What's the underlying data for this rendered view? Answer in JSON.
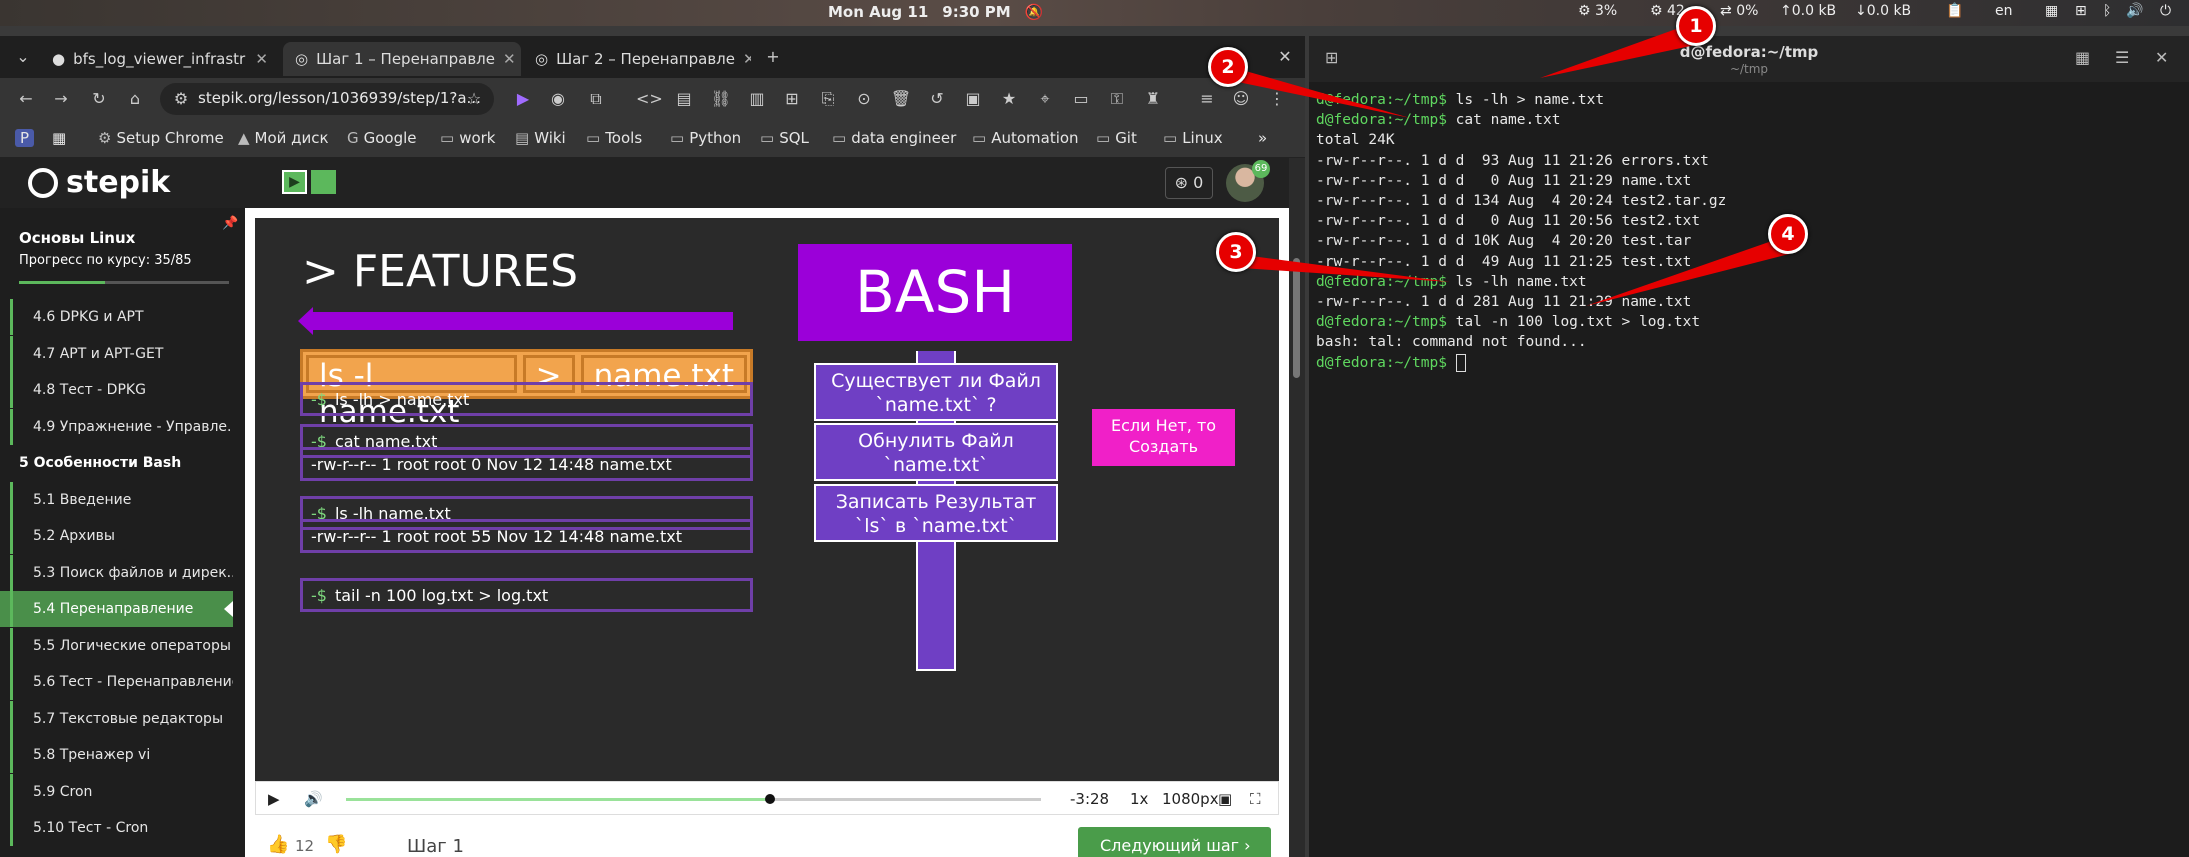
{
  "topbar": {
    "date": "Mon Aug 11",
    "time": "9:30 PM",
    "cpu": "3%",
    "cpu2": "42",
    "net_pct": "0%",
    "up": "↑0.0 kB",
    "down": "↓0.0 kB",
    "lang": "en"
  },
  "browser": {
    "tabs": [
      {
        "label": "bfs_log_viewer_infrastr",
        "icon": "github-icon"
      },
      {
        "label": "Шаг 1 – Перенаправле",
        "icon": "stepik-icon"
      },
      {
        "label": "Шаг 2 – Перенаправле",
        "icon": "stepik-icon"
      }
    ],
    "url": "stepik.org/lesson/1036939/step/1?a...",
    "bookmarks": [
      "Setup Chrome",
      "Мой диск",
      "Google",
      "work",
      "Wiki",
      "Tools",
      "Python",
      "SQL",
      "data engineer",
      "Automation",
      "Git",
      "Linux"
    ]
  },
  "stepik": {
    "logo": "stepik",
    "points": "0",
    "avatar_badge": "69",
    "course_title": "Основы Linux",
    "course_progress": "Прогресс по курсу:  35/85",
    "progress_fraction": 0.41,
    "items": [
      {
        "label": "4.6  DPKG и APT",
        "type": "item"
      },
      {
        "label": "4.7  APT и APT-GET",
        "type": "item"
      },
      {
        "label": "4.8  Тест - DPKG",
        "type": "item"
      },
      {
        "label": "4.9  Упражнение - Управле...",
        "type": "item"
      },
      {
        "label": "5  Особенности Bash",
        "type": "module"
      },
      {
        "label": "5.1  Введение",
        "type": "item"
      },
      {
        "label": "5.2  Архивы",
        "type": "item"
      },
      {
        "label": "5.3  Поиск файлов и дирек...",
        "type": "item"
      },
      {
        "label": "5.4  Перенаправление",
        "type": "active"
      },
      {
        "label": "5.5  Логические операторы",
        "type": "item"
      },
      {
        "label": "5.6  Тест - Перенаправление",
        "type": "item"
      },
      {
        "label": "5.7  Текстовые редакторы",
        "type": "item"
      },
      {
        "label": "5.8  Тренажер vi",
        "type": "item"
      },
      {
        "label": "5.9  Cron",
        "type": "item"
      },
      {
        "label": "5.10  Тест - Cron",
        "type": "item"
      }
    ],
    "slide": {
      "features": "> FEATURES",
      "bash": "BASH",
      "cmd_parts": [
        "ls  -l  name.txt",
        ">",
        "name.txt"
      ],
      "lines": [
        {
          "prompt": "-$",
          "text": "ls  -lh  >  name.txt"
        },
        {
          "prompt": "-$",
          "text": "cat  name.txt"
        },
        {
          "prompt": "",
          "text": "-rw-r--r-- 1 root root 0 Nov 12 14:48 name.txt"
        },
        {
          "prompt": "-$",
          "text": "ls  -lh  name.txt"
        },
        {
          "prompt": "",
          "text": "-rw-r--r-- 1 root root 55 Nov 12 14:48 name.txt"
        },
        {
          "prompt": "-$",
          "text": "tail  -n  100  log.txt  >  log.txt"
        }
      ],
      "flow": [
        "Существует ли Файл `name.txt` ?",
        "Обнулить Файл `name.txt`",
        "Записать Результат `ls` в `name.txt`"
      ],
      "if_not": "Если Нет, то Создать"
    },
    "player": {
      "remaining": "-3:28",
      "speed": "1x",
      "quality": "1080px",
      "progress_fraction": 0.61
    },
    "likes": "12",
    "step_label": "Шаг 1",
    "next_label": "Следующий шаг"
  },
  "terminal": {
    "title": "d@fedora:~/tmp",
    "subtitle": "~/tmp",
    "lines": [
      {
        "prompt": "d@fedora:~/tmp$",
        "text": " ls -lh > name.txt"
      },
      {
        "prompt": "d@fedora:~/tmp$",
        "text": " cat name.txt"
      },
      {
        "prompt": "",
        "text": "total 24K"
      },
      {
        "prompt": "",
        "text": "-rw-r--r--. 1 d d  93 Aug 11 21:26 errors.txt"
      },
      {
        "prompt": "",
        "text": "-rw-r--r--. 1 d d   0 Aug 11 21:29 name.txt"
      },
      {
        "prompt": "",
        "text": "-rw-r--r--. 1 d d 134 Aug  4 20:24 test2.tar.gz"
      },
      {
        "prompt": "",
        "text": "-rw-r--r--. 1 d d   0 Aug 11 20:56 test2.txt"
      },
      {
        "prompt": "",
        "text": "-rw-r--r--. 1 d d 10K Aug  4 20:20 test.tar"
      },
      {
        "prompt": "",
        "text": "-rw-r--r--. 1 d d  49 Aug 11 21:25 test.txt"
      },
      {
        "prompt": "d@fedora:~/tmp$",
        "text": " ls -lh name.txt"
      },
      {
        "prompt": "",
        "text": "-rw-r--r--. 1 d d 281 Aug 11 21:29 name.txt"
      },
      {
        "prompt": "d@fedora:~/tmp$",
        "text": " tal -n 100 log.txt > log.txt"
      },
      {
        "prompt": "",
        "text": "bash: tal: command not found..."
      },
      {
        "prompt": "d@fedora:~/tmp$",
        "text": " "
      }
    ]
  },
  "callouts": [
    "1",
    "2",
    "3",
    "4"
  ],
  "colors": {
    "stepik_green": "#5cb85c",
    "slide_purple": "#9b00d9",
    "callout_red": "#e60000"
  }
}
